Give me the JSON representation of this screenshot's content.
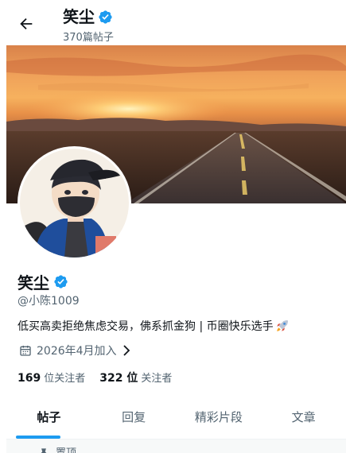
{
  "header": {
    "title": "笑尘",
    "post_count": "370篇帖子",
    "back_icon": "arrow-left-icon"
  },
  "profile": {
    "display_name": "笑尘",
    "handle": "@小陈1009",
    "bio": "低买高卖拒绝焦虑交易，佛系抓金狗 | 币圈快乐选手",
    "bio_emoji_icon": "rocket-icon",
    "joined": "2026年4月加入",
    "following_count": "169",
    "following_label": "位关注者",
    "followers_count": "322 位",
    "followers_label": "关注者",
    "verified_color": "#1d9bf0"
  },
  "tabs": [
    {
      "label": "帖子",
      "active": true
    },
    {
      "label": "回复",
      "active": false
    },
    {
      "label": "精彩片段",
      "active": false
    },
    {
      "label": "文章",
      "active": false
    }
  ],
  "pinned": {
    "label": "置顶",
    "icon": "pin-icon"
  },
  "colors": {
    "accent": "#1d9bf0",
    "text": "#0f1419",
    "muted": "#536471"
  }
}
